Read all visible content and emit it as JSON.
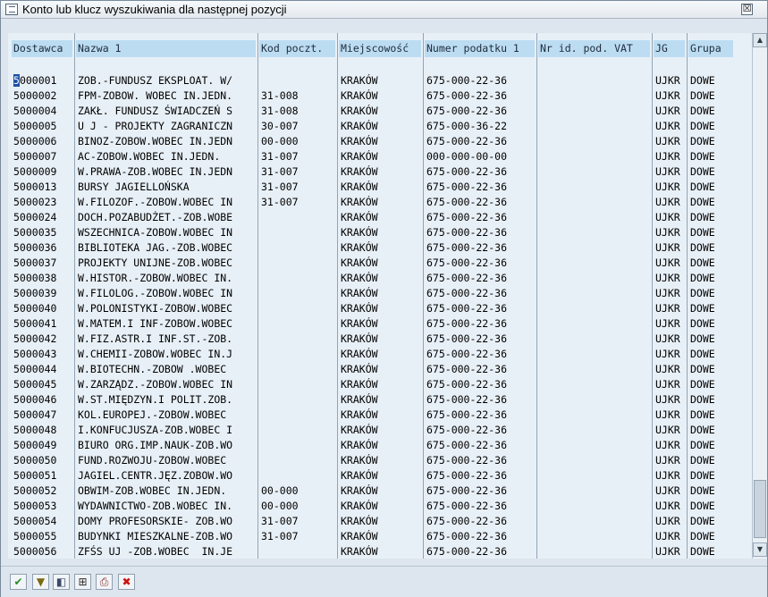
{
  "window": {
    "title": "Konto lub klucz wyszukiwania dla następnej pozycji",
    "close_glyph": "☒"
  },
  "columns": [
    {
      "key": "dostawca",
      "label": "Dostawca"
    },
    {
      "key": "nazwa",
      "label": "Nazwa 1"
    },
    {
      "key": "kod",
      "label": "Kod poczt."
    },
    {
      "key": "miejscowosc",
      "label": "Miejscowość"
    },
    {
      "key": "numer",
      "label": "Numer podatku 1"
    },
    {
      "key": "vat",
      "label": "Nr id. pod. VAT"
    },
    {
      "key": "jg",
      "label": "JG"
    },
    {
      "key": "grupa",
      "label": "Grupa"
    }
  ],
  "rows": [
    [
      "5000001",
      "ZOB.-FUNDUSZ EKSPLOAT. W/",
      "",
      "KRAKÓW",
      "675-000-22-36",
      "",
      "UJKR",
      "DOWE"
    ],
    [
      "5000002",
      "FPM-ZOBOW. WOBEC IN.JEDN.",
      "31-008",
      "KRAKÓW",
      "675-000-22-36",
      "",
      "UJKR",
      "DOWE"
    ],
    [
      "5000004",
      "ZAKŁ. FUNDUSZ ŚWIADCZEŃ S",
      "31-008",
      "KRAKÓW",
      "675-000-22-36",
      "",
      "UJKR",
      "DOWE"
    ],
    [
      "5000005",
      "U J - PROJEKTY ZAGRANICZN",
      "30-007",
      "KRAKÓW",
      "675-000-36-22",
      "",
      "UJKR",
      "DOWE"
    ],
    [
      "5000006",
      "BINOZ-ZOBOW.WOBEC IN.JEDN",
      "00-000",
      "KRAKÓW",
      "675-000-22-36",
      "",
      "UJKR",
      "DOWE"
    ],
    [
      "5000007",
      "AC-ZOBOW.WOBEC IN.JEDN.",
      "31-007",
      "KRAKÓW",
      "000-000-00-00",
      "",
      "UJKR",
      "DOWE"
    ],
    [
      "5000009",
      "W.PRAWA-ZOB.WOBEC IN.JEDN",
      "31-007",
      "KRAKÓW",
      "675-000-22-36",
      "",
      "UJKR",
      "DOWE"
    ],
    [
      "5000013",
      "BURSY JAGIELLOŃSKA",
      "31-007",
      "KRAKÓW",
      "675-000-22-36",
      "",
      "UJKR",
      "DOWE"
    ],
    [
      "5000023",
      "W.FILOZOF.-ZOBOW.WOBEC IN",
      "31-007",
      "KRAKÓW",
      "675-000-22-36",
      "",
      "UJKR",
      "DOWE"
    ],
    [
      "5000024",
      "DOCH.POZABUDŻET.-ZOB.WOBE",
      "",
      "KRAKÓW",
      "675-000-22-36",
      "",
      "UJKR",
      "DOWE"
    ],
    [
      "5000035",
      "WSZECHNICA-ZOBOW.WOBEC IN",
      "",
      "KRAKÓW",
      "675-000-22-36",
      "",
      "UJKR",
      "DOWE"
    ],
    [
      "5000036",
      "BIBLIOTEKA JAG.-ZOB.WOBEC",
      "",
      "KRAKÓW",
      "675-000-22-36",
      "",
      "UJKR",
      "DOWE"
    ],
    [
      "5000037",
      "PROJEKTY UNIJNE-ZOB.WOBEC",
      "",
      "KRAKÓW",
      "675-000-22-36",
      "",
      "UJKR",
      "DOWE"
    ],
    [
      "5000038",
      "W.HISTOR.-ZOBOW.WOBEC IN.",
      "",
      "KRAKÓW",
      "675-000-22-36",
      "",
      "UJKR",
      "DOWE"
    ],
    [
      "5000039",
      "W.FILOLOG.-ZOBOW.WOBEC IN",
      "",
      "KRAKÓW",
      "675-000-22-36",
      "",
      "UJKR",
      "DOWE"
    ],
    [
      "5000040",
      "W.POLONISTYKI-ZOBOW.WOBEC",
      "",
      "KRAKÓW",
      "675-000-22-36",
      "",
      "UJKR",
      "DOWE"
    ],
    [
      "5000041",
      "W.MATEM.I INF-ZOBOW.WOBEC",
      "",
      "KRAKÓW",
      "675-000-22-36",
      "",
      "UJKR",
      "DOWE"
    ],
    [
      "5000042",
      "W.FIZ.ASTR.I INF.ST.-ZOB.",
      "",
      "KRAKÓW",
      "675-000-22-36",
      "",
      "UJKR",
      "DOWE"
    ],
    [
      "5000043",
      "W.CHEMII-ZOBOW.WOBEC IN.J",
      "",
      "KRAKÓW",
      "675-000-22-36",
      "",
      "UJKR",
      "DOWE"
    ],
    [
      "5000044",
      "W.BIOTECHN.-ZOBOW .WOBEC",
      "",
      "KRAKÓW",
      "675-000-22-36",
      "",
      "UJKR",
      "DOWE"
    ],
    [
      "5000045",
      "W.ZARZĄDZ.-ZOBOW.WOBEC IN",
      "",
      "KRAKÓW",
      "675-000-22-36",
      "",
      "UJKR",
      "DOWE"
    ],
    [
      "5000046",
      "W.ST.MIĘDZYN.I POLIT.ZOB.",
      "",
      "KRAKÓW",
      "675-000-22-36",
      "",
      "UJKR",
      "DOWE"
    ],
    [
      "5000047",
      "KOL.EUROPEJ.-ZOBOW.WOBEC",
      "",
      "KRAKÓW",
      "675-000-22-36",
      "",
      "UJKR",
      "DOWE"
    ],
    [
      "5000048",
      "I.KONFUCJUSZA-ZOB.WOBEC I",
      "",
      "KRAKÓW",
      "675-000-22-36",
      "",
      "UJKR",
      "DOWE"
    ],
    [
      "5000049",
      "BIURO ORG.IMP.NAUK-ZOB.WO",
      "",
      "KRAKÓW",
      "675-000-22-36",
      "",
      "UJKR",
      "DOWE"
    ],
    [
      "5000050",
      "FUND.ROZWOJU-ZOBOW.WOBEC",
      "",
      "KRAKÓW",
      "675-000-22-36",
      "",
      "UJKR",
      "DOWE"
    ],
    [
      "5000051",
      "JAGIEL.CENTR.JĘZ.ZOBOW.WO",
      "",
      "KRAKÓW",
      "675-000-22-36",
      "",
      "UJKR",
      "DOWE"
    ],
    [
      "5000052",
      "OBWIM-ZOB.WOBEC IN.JEDN.",
      "00-000",
      "KRAKÓW",
      "675-000-22-36",
      "",
      "UJKR",
      "DOWE"
    ],
    [
      "5000053",
      "WYDAWNICTWO-ZOB.WOBEC IN.",
      "00-000",
      "KRAKÓW",
      "675-000-22-36",
      "",
      "UJKR",
      "DOWE"
    ],
    [
      "5000054",
      "DOMY PROFESORSKIE- ZOB.WO",
      "31-007",
      "KRAKÓW",
      "675-000-22-36",
      "",
      "UJKR",
      "DOWE"
    ],
    [
      "5000055",
      "BUDYNKI MIESZKALNE-ZOB.WO",
      "31-007",
      "KRAKÓW",
      "675-000-22-36",
      "",
      "UJKR",
      "DOWE"
    ],
    [
      "5000056",
      "ZFŚS UJ -ZOB.WOBEC  IN.JE",
      "",
      "KRAKÓW",
      "675-000-22-36",
      "",
      "UJKR",
      "DOWE"
    ]
  ],
  "scrollbar": {
    "up_glyph": "▲",
    "down_glyph": "▼"
  },
  "toolbar": {
    "buttons": [
      {
        "name": "confirm-button",
        "icon": "check-icon",
        "glyph": "✔",
        "color": "#2a8a2a"
      },
      {
        "name": "filter-button",
        "icon": "filter-icon",
        "glyph": "▼",
        "color": "#7a6a10"
      },
      {
        "name": "restrict-button",
        "icon": "restrict-icon",
        "glyph": "◧",
        "color": "#3a4a6a"
      },
      {
        "name": "find-button",
        "icon": "binoculars-icon",
        "glyph": "⊞",
        "color": "#2b2b2b"
      },
      {
        "name": "print-button",
        "icon": "printer-icon",
        "glyph": "⎙",
        "color": "#8a2a2a"
      },
      {
        "name": "cancel-button",
        "icon": "cancel-icon",
        "glyph": "✖",
        "color": "#cc1111"
      }
    ]
  }
}
